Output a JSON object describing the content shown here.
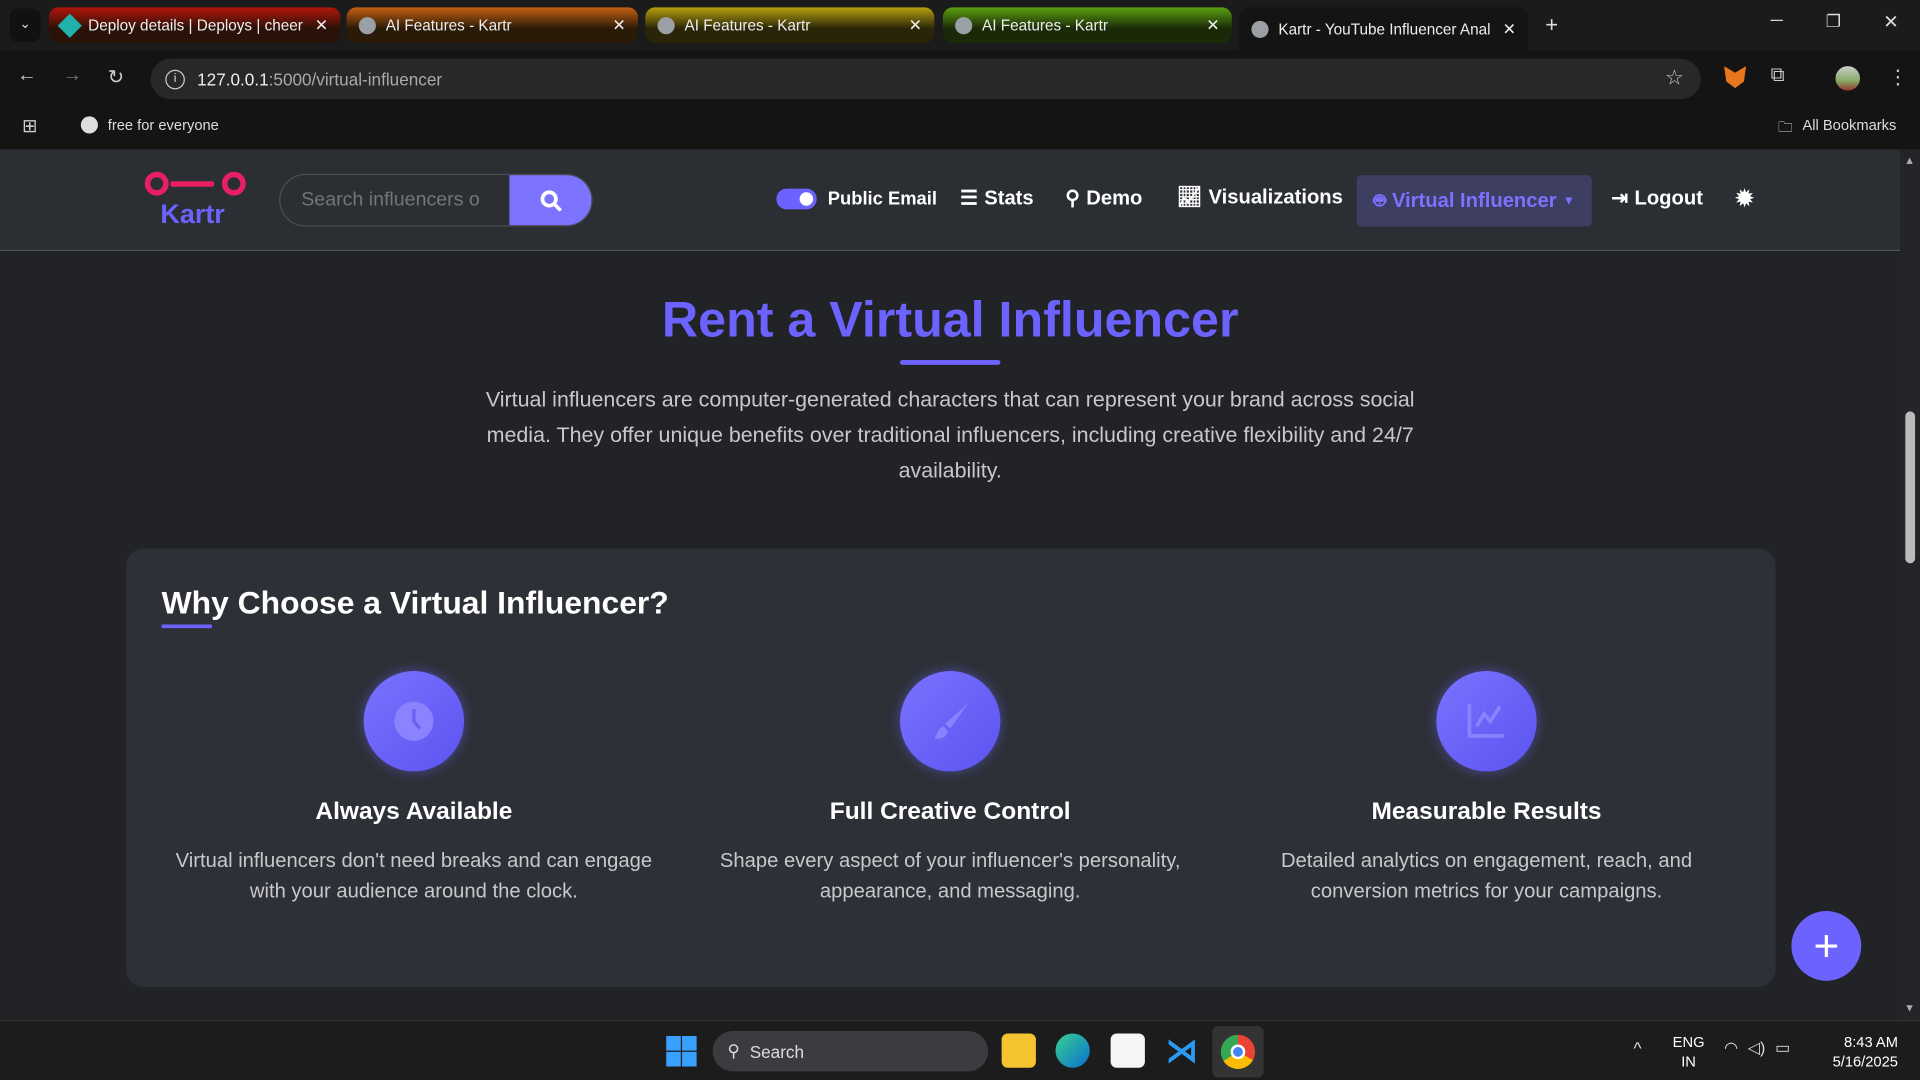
{
  "browser": {
    "tabs": [
      {
        "title": "Deploy details | Deploys | cheer",
        "color": "#7a1a10"
      },
      {
        "title": "AI Features - Kartr",
        "color": "#6a3a08"
      },
      {
        "title": "AI Features - Kartr",
        "color": "#5a5008"
      },
      {
        "title": "AI Features - Kartr",
        "color": "#3a5508"
      },
      {
        "title": "Kartr - YouTube Influencer Anal",
        "color": "#0f0f0f"
      }
    ],
    "url_host": "127.0.0.1",
    "url_rest": ":5000/virtual-influencer",
    "bookmark": "free for everyone",
    "all_bookmarks": "All Bookmarks"
  },
  "nav": {
    "logo": "Kartr",
    "search_placeholder": "Search influencers o",
    "public_email": "Public Email",
    "public_email_on": true,
    "stats": "Stats",
    "demo": "Demo",
    "visualizations": "Visualizations",
    "virtual_influencer": "Virtual Influencer",
    "logout": "Logout"
  },
  "hero": {
    "title": "Rent a Virtual Influencer",
    "description": "Virtual influencers are computer-generated characters that can represent your brand across social media. They offer unique benefits over traditional influencers, including creative flexibility and 24/7 availability."
  },
  "why": {
    "title": "Why Choose a Virtual Influencer?",
    "features": [
      {
        "icon": "clock-icon",
        "title": "Always Available",
        "text": "Virtual influencers don't need breaks and can engage with your audience around the clock."
      },
      {
        "icon": "paintbrush-icon",
        "title": "Full Creative Control",
        "text": "Shape every aspect of your influencer's personality, appearance, and messaging."
      },
      {
        "icon": "chart-line-icon",
        "title": "Measurable Results",
        "text": "Detailed analytics on engagement, reach, and conversion metrics for your campaigns."
      }
    ]
  },
  "taskbar": {
    "search": "Search",
    "lang1": "ENG",
    "lang2": "IN",
    "time": "8:43 AM",
    "date": "5/16/2025"
  },
  "colors": {
    "accent": "#6c63ff",
    "brand_pink": "#e91e63"
  }
}
